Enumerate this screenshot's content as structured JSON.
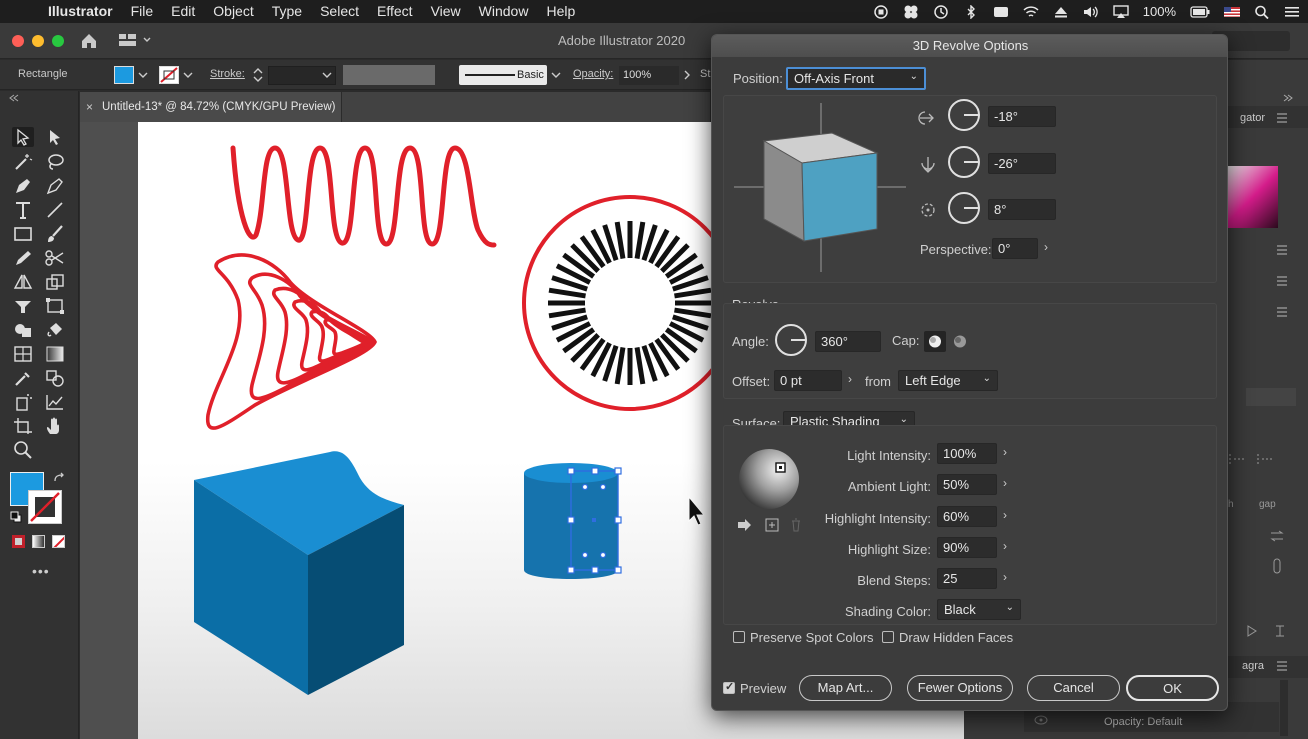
{
  "menubar": {
    "app": "Illustrator",
    "items": [
      "File",
      "Edit",
      "Object",
      "Type",
      "Select",
      "Effect",
      "View",
      "Window",
      "Help"
    ],
    "battery": "100%"
  },
  "appbar": {
    "title": "Adobe Illustrator 2020"
  },
  "control": {
    "selection": "Rectangle",
    "stroke_label": "Stroke:",
    "brush": "Basic",
    "opacity_label": "Opacity:",
    "opacity_value": "100%",
    "style_label": "St"
  },
  "document": {
    "tab_title": "Untitled-13* @ 84.72% (CMYK/GPU Preview)",
    "close": "×"
  },
  "dock": {
    "navigator_tab": "gator",
    "gap_label": "gap",
    "h_label": "h",
    "paragraph_tab": "agra",
    "opacity_text": "Opacity: Default"
  },
  "dialog": {
    "title": "3D Revolve Options",
    "position": {
      "label": "Position:",
      "value": "Off-Axis Front"
    },
    "rotation": {
      "x": "-18°",
      "y": "-26°",
      "z": "8°"
    },
    "perspective": {
      "label": "Perspective:",
      "value": "0°"
    },
    "revolve": {
      "heading": "Revolve",
      "angle_label": "Angle:",
      "angle": "360°",
      "cap_label": "Cap:",
      "offset_label": "Offset:",
      "offset": "0 pt",
      "from_label": "from",
      "from": "Left Edge"
    },
    "surface": {
      "label": "Surface:",
      "value": "Plastic Shading",
      "light_intensity_label": "Light Intensity:",
      "light_intensity": "100%",
      "ambient_light_label": "Ambient Light:",
      "ambient_light": "50%",
      "highlight_intensity_label": "Highlight Intensity:",
      "highlight_intensity": "60%",
      "highlight_size_label": "Highlight Size:",
      "highlight_size": "90%",
      "blend_steps_label": "Blend Steps:",
      "blend_steps": "25",
      "shading_color_label": "Shading Color:",
      "shading_color": "Black"
    },
    "options": {
      "preserve_spot": "Preserve Spot Colors",
      "draw_hidden": "Draw Hidden Faces"
    },
    "buttons": {
      "preview": "Preview",
      "map_art": "Map Art...",
      "fewer": "Fewer Options",
      "cancel": "Cancel",
      "ok": "OK"
    }
  },
  "colors": {
    "accent_blue": "#1c9ae0",
    "red": "#e0202a",
    "dialog_bg": "#3c3c3c"
  }
}
